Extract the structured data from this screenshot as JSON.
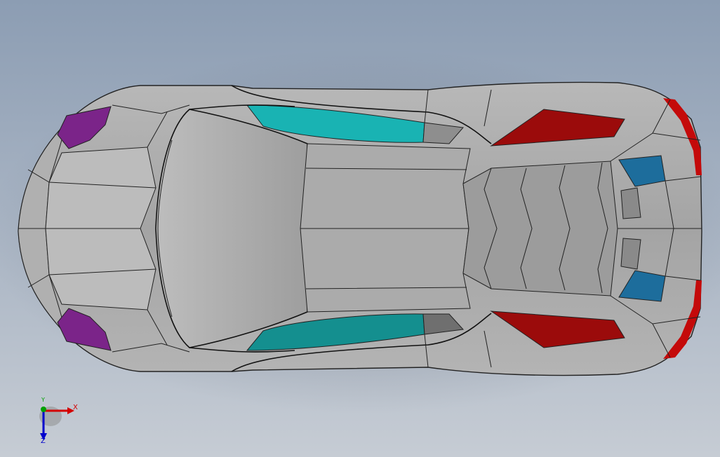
{
  "viewport": {
    "background_top": "#8c9db3",
    "background_bottom": "#c6ccd4",
    "model_name": ""
  },
  "colors": {
    "body": "#a8a8a8",
    "body_light": "#c4c4c4",
    "body_dark": "#8a8a8a",
    "window": "#19b3b3",
    "window_dark": "#148f8f",
    "taillight": "#9b0b0b",
    "headlight": "#7b2489",
    "vent": "#1d6d9c",
    "rear_red": "#c40a0a"
  },
  "triad": {
    "x_label": "X",
    "y_label": "Y",
    "z_label": "Z",
    "x_color": "#d40000",
    "y_color": "#00a000",
    "z_color": "#0000cc",
    "x_icon": "x-axis-arrow-icon",
    "y_icon": "y-axis-dot-icon",
    "z_icon": "z-axis-arrow-icon"
  }
}
